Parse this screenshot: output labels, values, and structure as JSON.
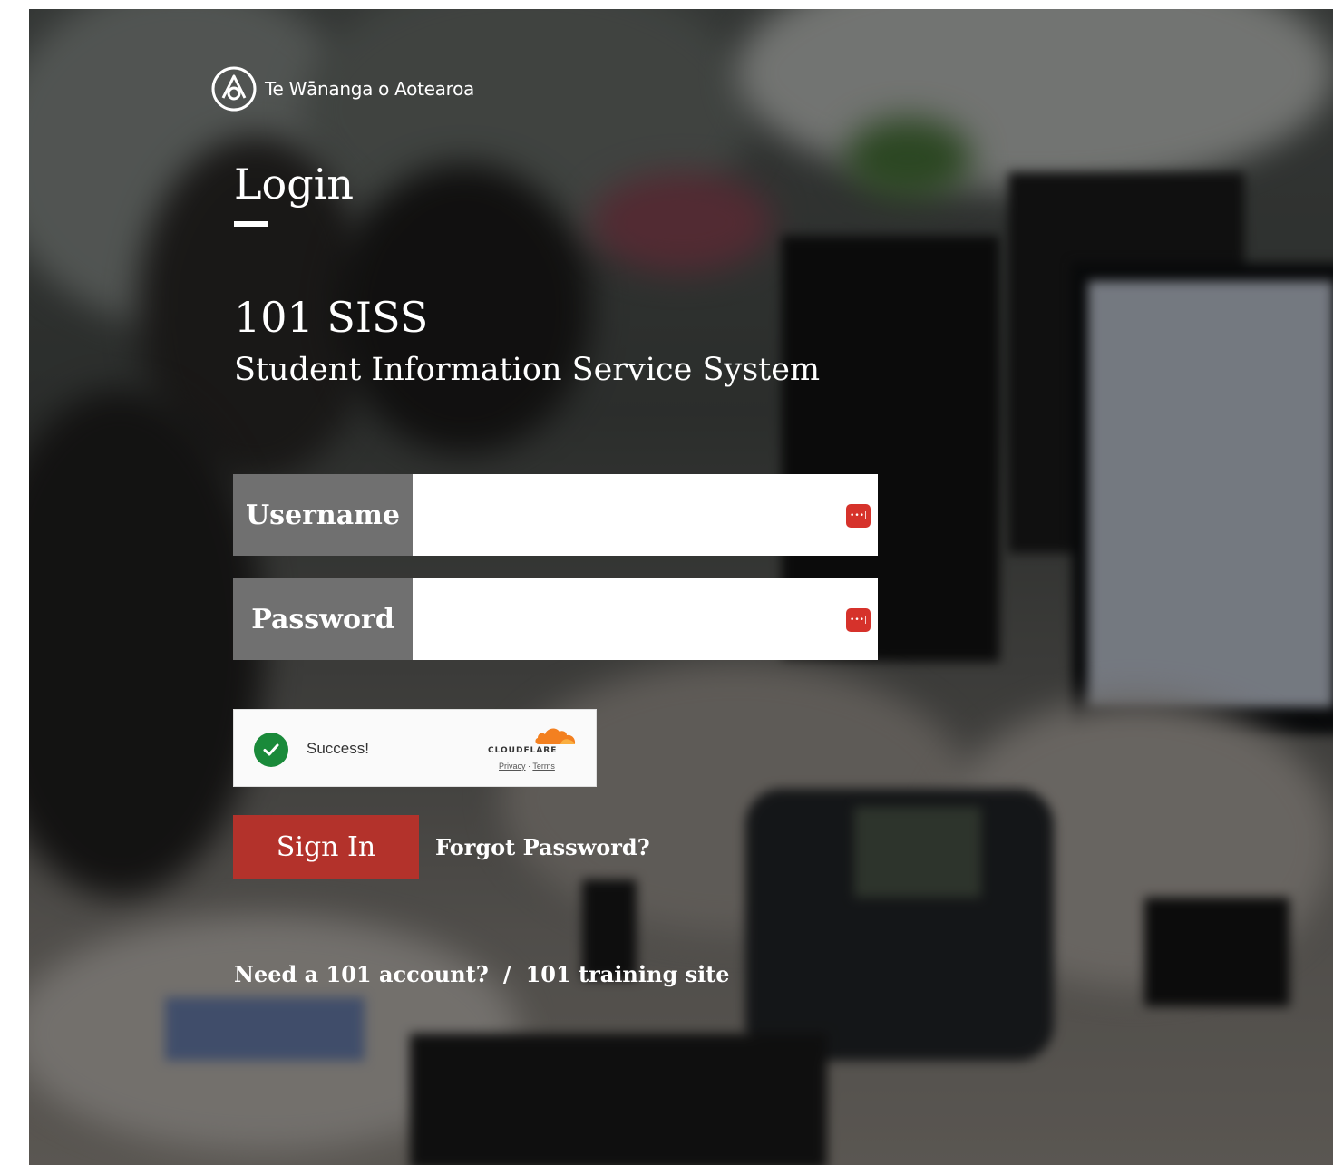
{
  "brand": {
    "name": "Te Wānanga o Aotearoa",
    "logo_icon": "twoa-logo-icon"
  },
  "login": {
    "title": "Login"
  },
  "app": {
    "name": "101 SISS",
    "subtitle": "Student Information Service System"
  },
  "form": {
    "username_label": "Username",
    "username_value": "",
    "password_label": "Password",
    "password_value": "",
    "password_manager_icon": "password-manager-icon"
  },
  "captcha": {
    "status": "Success!",
    "provider": "CLOUDFLARE",
    "privacy_link": "Privacy",
    "separator": "·",
    "terms_link": "Terms"
  },
  "actions": {
    "signin_label": "Sign In",
    "forgot_label": "Forgot Password?"
  },
  "footer": {
    "need_account": "Need a 101 account?",
    "separator": "/",
    "training_site": "101 training site"
  },
  "colors": {
    "primary": "#b3322b",
    "label_bg": "#707070",
    "captcha_success": "#1a8a3a",
    "password_icon": "#d6322b"
  }
}
